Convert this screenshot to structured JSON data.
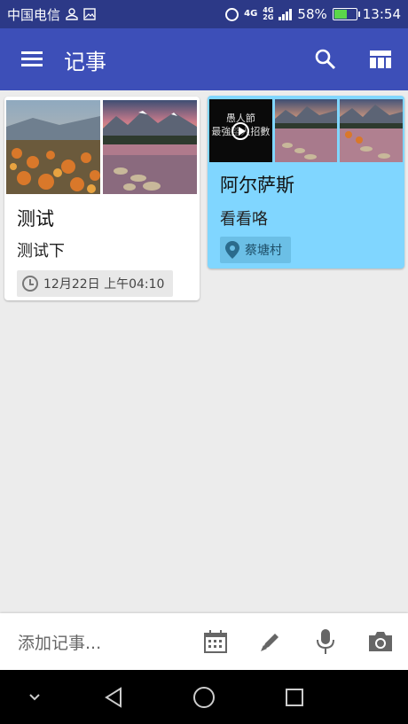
{
  "status_bar": {
    "carrier": "中国电信",
    "network_top": "4G",
    "network_sub_top": "4G",
    "network_sub_bottom": "2G",
    "battery_percent_label": "58%",
    "battery_level": 0.58,
    "time": "13:54"
  },
  "app_bar": {
    "title": "记事",
    "menu_icon": "hamburger-menu-icon",
    "search_icon": "search-icon",
    "layout_icon": "layout-view-icon"
  },
  "notes": [
    {
      "title": "测试",
      "body": "测试下",
      "chip_icon": "clock-icon",
      "chip_text": "12月22日 上午04:10",
      "background": "#ffffff"
    },
    {
      "title": "阿尔萨斯",
      "body": "看看咯",
      "chip_icon": "location-pin-icon",
      "chip_text": "蔡塘村",
      "background": "#80d6ff",
      "video_caption_line1": "愚人節",
      "video_caption_line2": "最強整人招數"
    }
  ],
  "bottom_bar": {
    "placeholder": "添加记事...",
    "tools": [
      "calendar-icon",
      "pen-icon",
      "microphone-icon",
      "camera-icon"
    ]
  },
  "nav_bar": {
    "buttons": [
      "chevron-down-icon",
      "back-triangle-icon",
      "home-circle-icon",
      "recents-square-icon"
    ]
  },
  "colors": {
    "status_bar": "#2c3987",
    "app_bar": "#3d4fb8",
    "card_highlight": "#80d6ff",
    "background": "#ececec"
  }
}
